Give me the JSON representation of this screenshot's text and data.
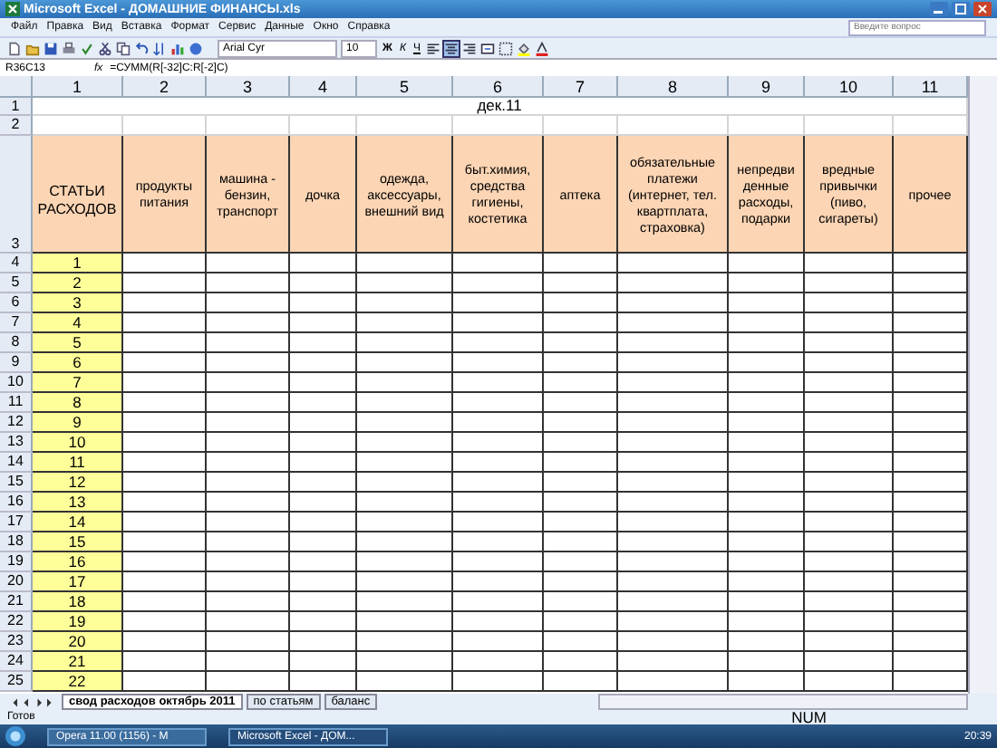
{
  "window": {
    "title": "Microsoft Excel - ДОМАШНИЕ ФИНАНСЫ.xls"
  },
  "menu": [
    "Файл",
    "Правка",
    "Вид",
    "Вставка",
    "Формат",
    "Сервис",
    "Данные",
    "Окно",
    "Справка"
  ],
  "help": {
    "placeholder": "Введите вопрос"
  },
  "toolbar": {
    "font": "Arial Cyr",
    "size": "10",
    "style_buttons": [
      "Ж",
      "К",
      "Ч"
    ]
  },
  "formula_bar": {
    "name_box": "R36C13",
    "fx": "fx",
    "formula": "=СУММ(R[-32]C:R[-2]C)"
  },
  "sheet": {
    "columns": [
      "1",
      "2",
      "3",
      "4",
      "5",
      "6",
      "7",
      "8",
      "9",
      "10",
      "11"
    ],
    "title": "дек.11",
    "headers": [
      "СТАТЬИ РАСХОДОВ",
      "продукты питания",
      "машина - бензин, транспорт",
      "дочка",
      "одежда, аксессуары, внешний вид",
      "быт.химия, средства гигиены, костетика",
      "аптека",
      "обязательные платежи (интернет, тел. квартплата, страховка)",
      "непредви денные расходы, подарки",
      "вредные привычки (пиво, сигареты)",
      "прочее"
    ],
    "row_numbers": [
      "1",
      "2",
      "3",
      "4",
      "5",
      "6",
      "7",
      "8",
      "9",
      "10",
      "11",
      "12",
      "13",
      "14",
      "15",
      "16",
      "17",
      "18",
      "19",
      "20",
      "21",
      "22",
      "23",
      "24",
      "25"
    ],
    "items": [
      "1",
      "2",
      "3",
      "4",
      "5",
      "6",
      "7",
      "8",
      "9",
      "10",
      "11",
      "12",
      "13",
      "14",
      "15",
      "16",
      "17",
      "18",
      "19",
      "20",
      "21",
      "22"
    ]
  },
  "sheet_tabs": [
    {
      "label": "свод расходов октябрь 2011",
      "selected": true
    },
    {
      "label": "по статьям",
      "selected": false
    },
    {
      "label": "баланс",
      "selected": false
    }
  ],
  "status_bar": {
    "left": "Готов",
    "right": "NUM"
  },
  "taskbar": {
    "tasks": [
      {
        "label": "Opera 11.00 (1156) - M",
        "selected": false
      },
      {
        "label": "Microsoft Excel - ДОМ...",
        "selected": true
      }
    ],
    "clock": "20:39"
  }
}
